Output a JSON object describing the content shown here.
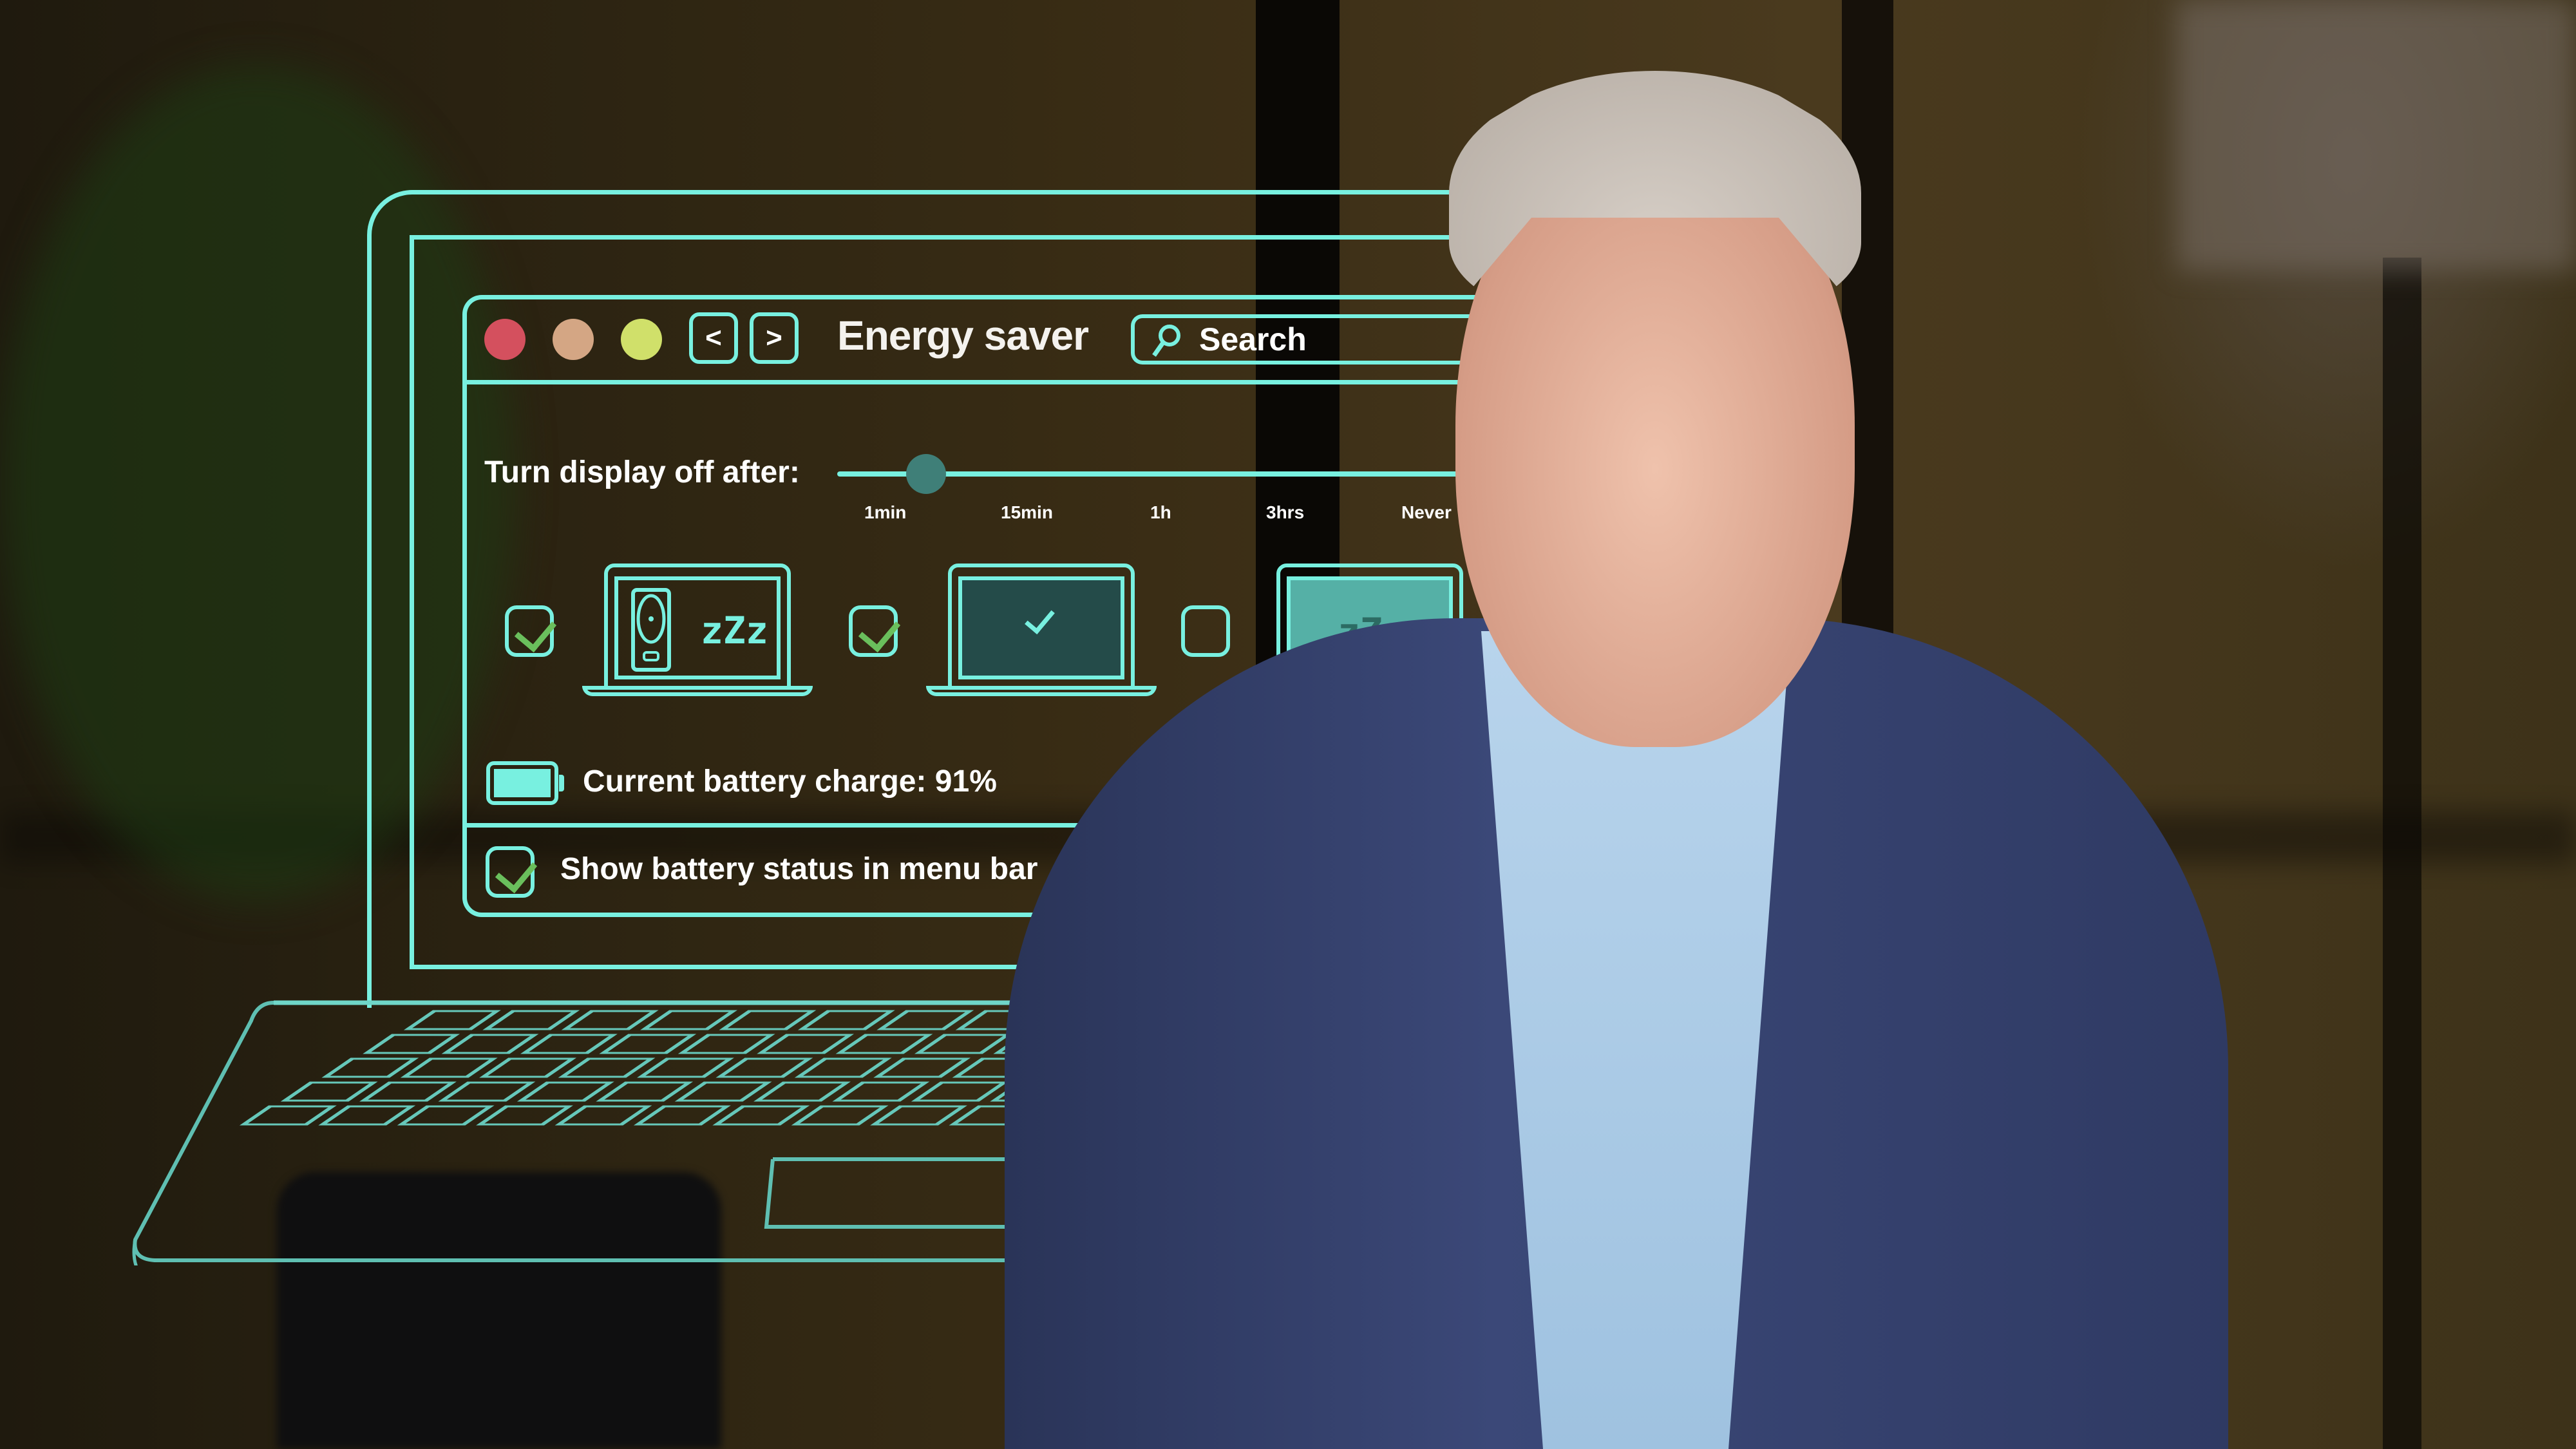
{
  "window": {
    "title": "Energy saver",
    "traffic_lights": [
      {
        "name": "close",
        "color": "#d4505e"
      },
      {
        "name": "minimize",
        "color": "#d4a684"
      },
      {
        "name": "zoom",
        "color": "#d0e06a"
      }
    ],
    "nav": {
      "back_label": "<",
      "forward_label": ">"
    },
    "search": {
      "placeholder": "Search",
      "icon": "magnifier-icon"
    }
  },
  "display_off": {
    "label": "Turn display off after:",
    "ticks": [
      "1min",
      "15min",
      "1h",
      "3hrs",
      "Never"
    ],
    "value_fraction": 0.1
  },
  "options": [
    {
      "checked": true,
      "icon": "hard-disk-sleep-icon",
      "zzz": "zZz"
    },
    {
      "checked": true,
      "icon": "display-on-icon"
    },
    {
      "checked": false,
      "icon": "display-sleep-icon",
      "zzz": "zZz"
    }
  ],
  "battery": {
    "label": "Current battery charge: 91%",
    "percent": 91
  },
  "menu_bar": {
    "label": "Show battery status in menu bar",
    "checked": true
  },
  "colors": {
    "accent": "#78f0e0",
    "check": "#6abf5c",
    "thumb": "#3f7f78",
    "screen_dark": "#244b49",
    "screen_sleep": "#55b0a6"
  }
}
